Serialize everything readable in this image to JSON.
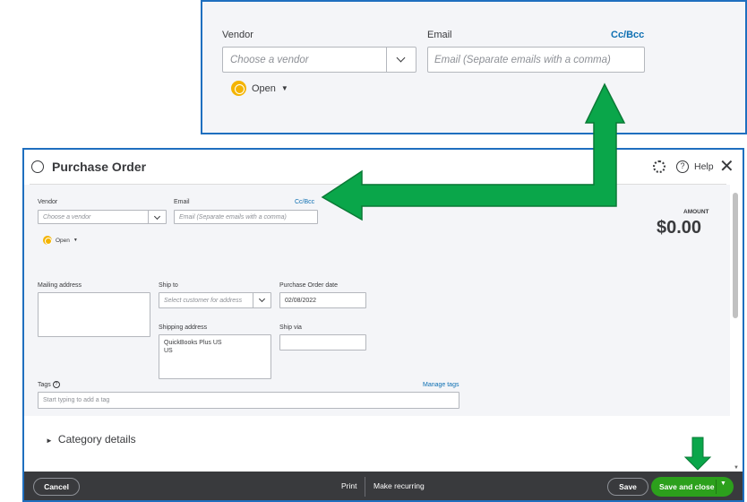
{
  "zoom": {
    "vendor_label": "Vendor",
    "vendor_placeholder": "Choose a vendor",
    "email_label": "Email",
    "email_placeholder": "Email (Separate emails with a comma)",
    "cc_bcc": "Cc/Bcc",
    "status": "Open"
  },
  "window": {
    "title": "Purchase Order",
    "help": "Help"
  },
  "form": {
    "vendor_label": "Vendor",
    "vendor_placeholder": "Choose a vendor",
    "email_label": "Email",
    "email_placeholder": "Email (Separate emails with a comma)",
    "cc_bcc": "Cc/Bcc",
    "status": "Open",
    "amount_label": "AMOUNT",
    "amount_value": "$0.00",
    "mailing_label": "Mailing address",
    "ship_to_label": "Ship to",
    "ship_to_placeholder": "Select customer for address",
    "po_date_label": "Purchase Order date",
    "po_date_value": "02/08/2022",
    "shipping_label": "Shipping address",
    "shipping_lines": [
      "QuickBooks Plus US",
      "US"
    ],
    "ship_via_label": "Ship via",
    "tags_label": "Tags",
    "manage_tags": "Manage tags",
    "tags_placeholder": "Start typing to add a tag"
  },
  "category_details": "Category details",
  "footer": {
    "cancel": "Cancel",
    "print": "Print",
    "make_recurring": "Make recurring",
    "save": "Save",
    "save_and_close": "Save and close"
  },
  "colors": {
    "accent_border": "#1f6fbf",
    "primary_button": "#2ca01c",
    "annotation_arrow": "#0aa64a",
    "status_icon": "#f4b400",
    "link": "#0d6fb2"
  }
}
